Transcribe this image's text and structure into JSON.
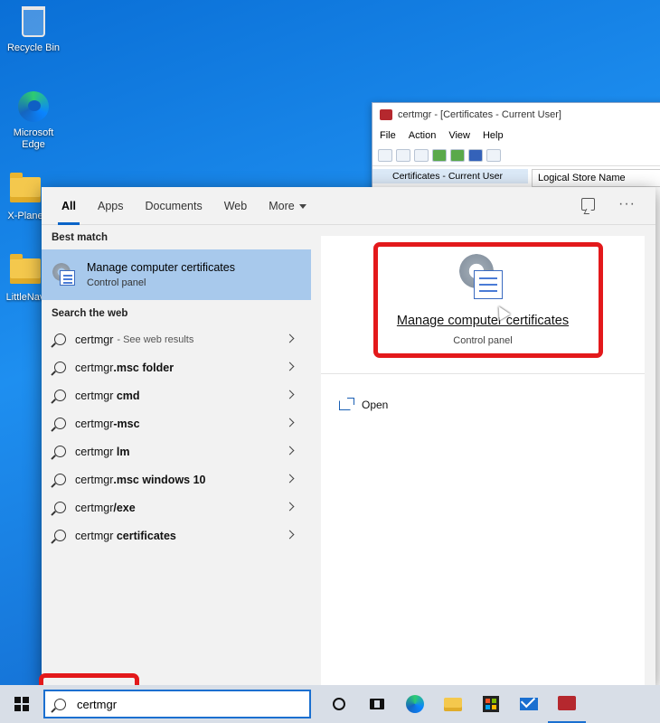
{
  "desktop": {
    "icons": [
      {
        "label": "Recycle Bin"
      },
      {
        "label": "Microsoft Edge"
      },
      {
        "label": "X-Plane"
      },
      {
        "label": "LittleNav"
      }
    ]
  },
  "certmgr_window": {
    "title": "certmgr - [Certificates - Current User]",
    "menu": [
      "File",
      "Action",
      "View",
      "Help"
    ],
    "tree_root": "Certificates - Current User",
    "column_header": "Logical Store Name"
  },
  "search_panel": {
    "tabs": [
      "All",
      "Apps",
      "Documents",
      "Web",
      "More"
    ],
    "best_match_label": "Best match",
    "best_match": {
      "title": "Manage computer certificates",
      "subtitle": "Control panel"
    },
    "search_web_label": "Search the web",
    "web_results": [
      {
        "prefix": "certmgr",
        "bold": "",
        "suffix": "- See web results"
      },
      {
        "prefix": "certmgr",
        "bold": ".msc folder",
        "suffix": ""
      },
      {
        "prefix": "certmgr",
        "bold": " cmd",
        "suffix": ""
      },
      {
        "prefix": "certmgr",
        "bold": "-msc",
        "suffix": ""
      },
      {
        "prefix": "certmgr",
        "bold": " lm",
        "suffix": ""
      },
      {
        "prefix": "certmgr",
        "bold": ".msc windows 10",
        "suffix": ""
      },
      {
        "prefix": "certmgr",
        "bold": "/exe",
        "suffix": ""
      },
      {
        "prefix": "certmgr",
        "bold": " certificates",
        "suffix": ""
      }
    ],
    "preview": {
      "title": "Manage computer certificates",
      "subtitle": "Control panel",
      "actions": [
        {
          "label": "Open"
        }
      ]
    }
  },
  "taskbar": {
    "search_value": "certmgr"
  },
  "colors": {
    "highlight": "#e3191b",
    "selection": "#a8c9ec",
    "accent": "#0a64c8"
  }
}
